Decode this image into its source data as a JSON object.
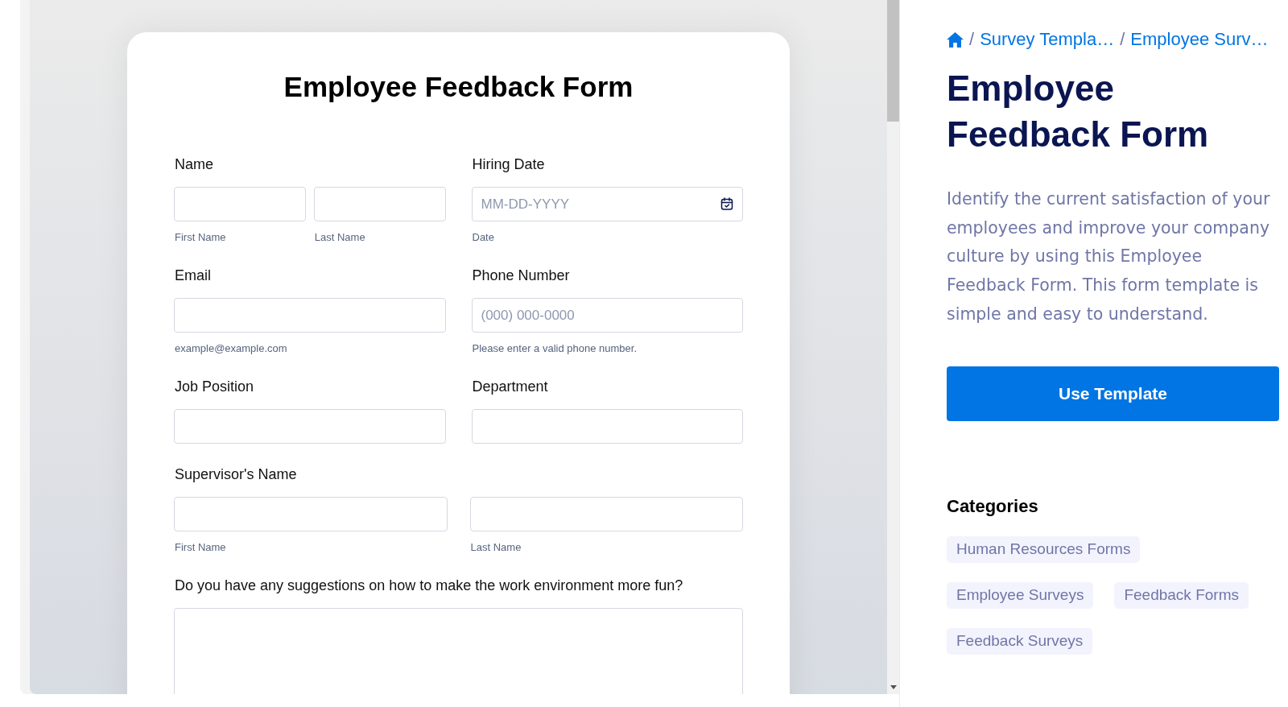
{
  "form_preview": {
    "title": "Employee Feedback Form",
    "rows": [
      [
        {
          "label": "Name",
          "inputs": [
            {
              "kind": "text",
              "sublabel": "First Name"
            },
            {
              "kind": "text",
              "sublabel": "Last Name"
            }
          ]
        },
        {
          "label": "Hiring Date",
          "inputs": [
            {
              "kind": "date",
              "placeholder": "MM-DD-YYYY",
              "sublabel": "Date"
            }
          ]
        }
      ],
      [
        {
          "label": "Email",
          "inputs": [
            {
              "kind": "text",
              "sublabel": "example@example.com"
            }
          ]
        },
        {
          "label": "Phone Number",
          "inputs": [
            {
              "kind": "text",
              "placeholder": "(000) 000-0000",
              "sublabel": "Please enter a valid phone number."
            }
          ]
        }
      ],
      [
        {
          "label": "Job Position",
          "inputs": [
            {
              "kind": "text"
            }
          ]
        },
        {
          "label": "Department",
          "inputs": [
            {
              "kind": "text"
            }
          ]
        }
      ],
      [
        {
          "label": "Supervisor's Name",
          "inputs": [
            {
              "kind": "text",
              "sublabel": "First Name"
            },
            {
              "kind": "text",
              "sublabel": "Last Name"
            }
          ]
        }
      ],
      [
        {
          "label": "Do you have any suggestions on how to make the work environment more fun?",
          "inputs": [
            {
              "kind": "textarea"
            }
          ]
        }
      ]
    ]
  },
  "template_panel": {
    "breadcrumb": [
      {
        "kind": "home"
      },
      {
        "kind": "separator",
        "text": "/"
      },
      {
        "kind": "link",
        "text": "Survey Templa…"
      },
      {
        "kind": "separator",
        "text": "/"
      },
      {
        "kind": "link",
        "text": "Employee Surv…"
      }
    ],
    "title": "Employee Feedback Form",
    "description": "Identify the current satisfaction of your employees and improve your company culture by using this Employee Feedback Form. This form template is simple and easy to understand.",
    "button": "Use Template",
    "categories_heading": "Categories",
    "categories": [
      "Human Resources Forms",
      "Employee Surveys",
      "Feedback Forms",
      "Feedback Surveys"
    ]
  }
}
